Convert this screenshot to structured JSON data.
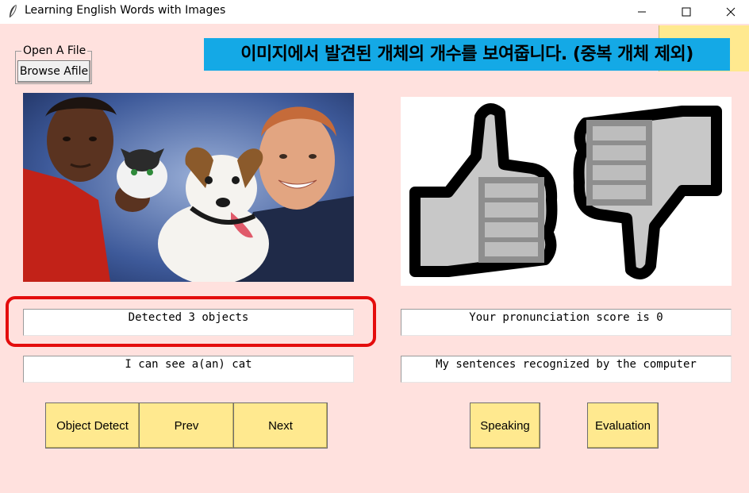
{
  "window": {
    "title": "Learning English Words with Images",
    "controls": [
      "minimize",
      "maximize",
      "close"
    ]
  },
  "file_frame": {
    "label": "Open A File",
    "browse_label": "Browse Afile"
  },
  "annotation": {
    "text": "이미지에서 발견된 개체의 개수를 보여줍니다. (중복 개체 제외)",
    "background": "#14a9e6"
  },
  "left_panel": {
    "detected_text": "Detected 3 objects",
    "sentence_text": "I can see a(an) cat"
  },
  "right_panel": {
    "score_text": "Your pronunciation score is 0",
    "recognized_text": "My sentences recognized by the computer"
  },
  "buttons": {
    "object_detect": "Object Detect",
    "prev": "Prev",
    "next": "Next",
    "speaking": "Speaking",
    "evaluation": "Evaluation"
  },
  "colors": {
    "window_bg": "#ffe1de",
    "button_bg": "#ffe98f",
    "highlight_border": "#e40d0d"
  }
}
